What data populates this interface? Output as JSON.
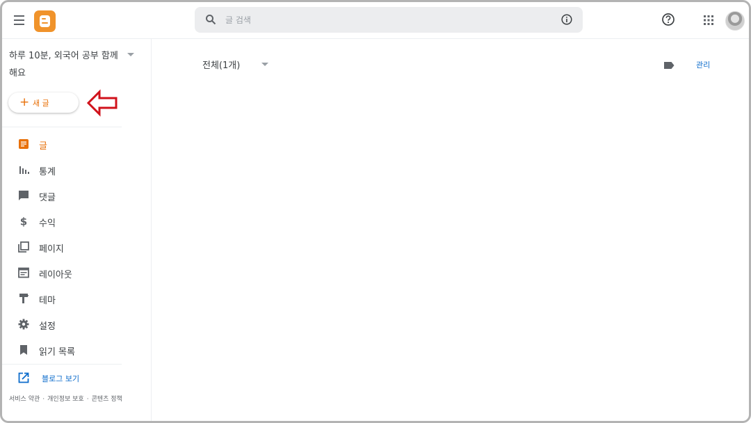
{
  "topbar": {
    "search_placeholder": "글 검색"
  },
  "sidebar": {
    "blog_title": "하루 10분, 외국어 공부 함께 해요",
    "new_post_label": "새 글",
    "nav": [
      {
        "label": "글",
        "icon": "posts-icon",
        "active": true
      },
      {
        "label": "통계",
        "icon": "stats-icon"
      },
      {
        "label": "댓글",
        "icon": "comments-icon"
      },
      {
        "label": "수익",
        "icon": "dollar-icon"
      },
      {
        "label": "페이지",
        "icon": "pages-icon"
      },
      {
        "label": "레이아웃",
        "icon": "layout-icon"
      },
      {
        "label": "테마",
        "icon": "theme-icon"
      },
      {
        "label": "설정",
        "icon": "gear-icon"
      },
      {
        "label": "읽기 목록",
        "icon": "bookmark-icon"
      }
    ],
    "view_blog_label": "블로그 보기",
    "footer": {
      "terms": "서비스 약관",
      "privacy": "개인정보 보호",
      "content_policy": "콘텐츠 정책",
      "separator": "·"
    }
  },
  "main": {
    "filter_label": "전체(1개)",
    "manage_label": "관리"
  },
  "colors": {
    "accent": "#e8710a",
    "logo": "#f0932b",
    "annotation_arrow": "#d0121b",
    "link": "#0b6bcb"
  }
}
